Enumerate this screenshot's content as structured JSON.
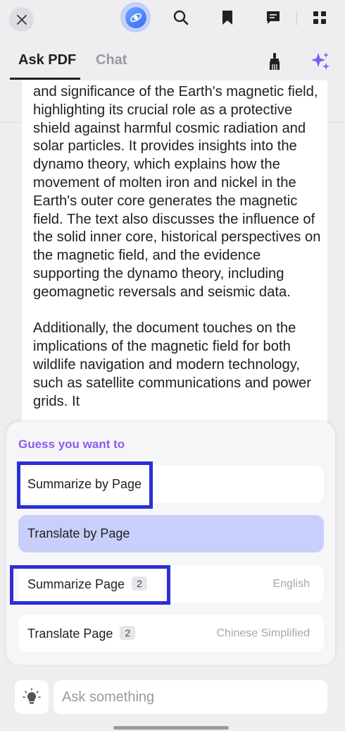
{
  "tabs": {
    "ask_pdf": "Ask PDF",
    "chat": "Chat"
  },
  "document": {
    "paragraphs": [
      "and significance of the Earth's magnetic field, highlighting its crucial role as a protective shield against harmful cosmic radiation and solar particles. It provides insights into the dynamo theory, which explains how the movement of molten iron and nickel in the Earth's outer core generates the magnetic field. The text also discusses the influence of the solid inner core, historical perspectives on the magnetic field, and the evidence supporting the dynamo theory, including geomagnetic reversals and seismic data.",
      "Additionally, the document touches on the implications of the magnetic field for both wildlife navigation and modern technology, such as satellite communications and power grids. It"
    ]
  },
  "suggestions": {
    "title": "Guess you want to",
    "options": [
      {
        "label": "Summarize by Page"
      },
      {
        "label": "Translate by Page"
      },
      {
        "label": "Summarize Page",
        "badge": "2",
        "detail": "English"
      },
      {
        "label": "Translate Page",
        "badge": "2",
        "detail": "Chinese Simplified"
      }
    ]
  },
  "input": {
    "placeholder": "Ask something"
  },
  "colors": {
    "accent": "#8a5cf0",
    "highlight_box": "#2b2fd4",
    "selected_option": "#c9cffb"
  }
}
